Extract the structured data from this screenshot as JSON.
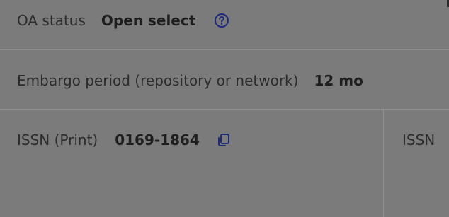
{
  "oa": {
    "label": "OA status",
    "value": "Open select"
  },
  "embargo": {
    "label": "Embargo period (repository or network)",
    "value": "12 mo"
  },
  "issn": {
    "print_label": "ISSN (Print)",
    "print_value": "0169-1864",
    "other_label": "ISSN"
  },
  "icons": {
    "help": "question-circle-icon",
    "copy": "copy-icon",
    "accent": "#1f2a78"
  }
}
